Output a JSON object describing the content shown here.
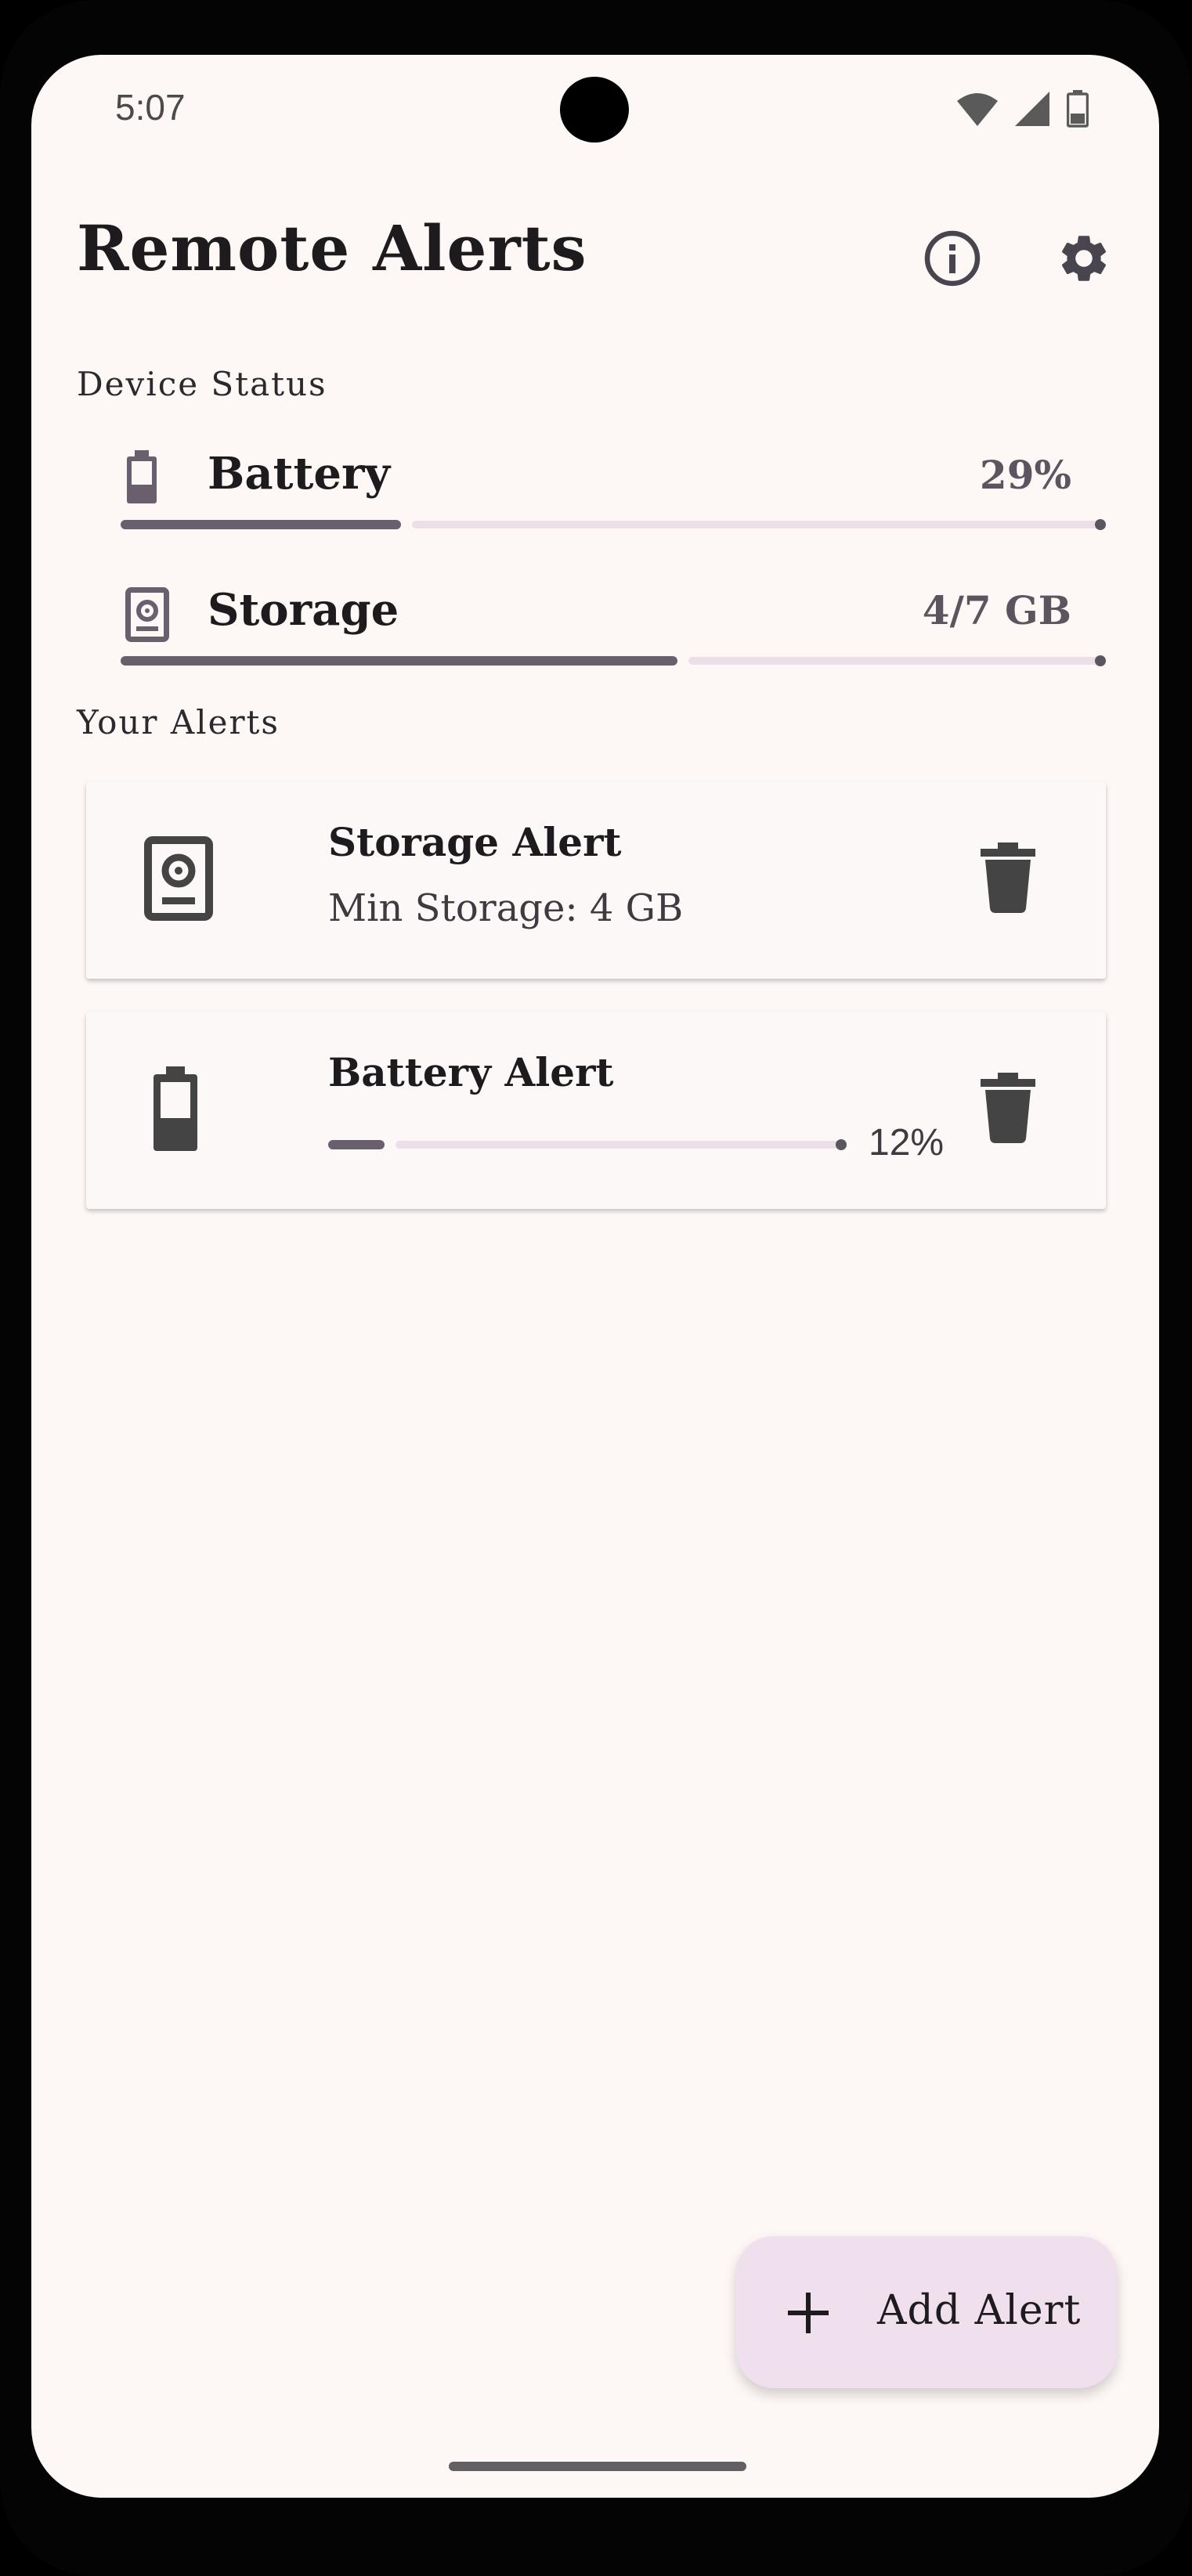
{
  "status_bar": {
    "time": "5:07"
  },
  "app_bar": {
    "title": "Remote Alerts"
  },
  "device_status": {
    "label": "Device Status",
    "battery": {
      "name": "Battery",
      "value": "29%",
      "level": 0.29
    },
    "storage": {
      "name": "Storage",
      "value": "4/7 GB",
      "level": 0.571
    }
  },
  "alerts": {
    "label": "Your Alerts",
    "items": [
      {
        "title": "Storage Alert",
        "detail": "Min Storage: 4 GB"
      },
      {
        "title": "Battery Alert",
        "value": "12%",
        "level": 0.12
      }
    ]
  },
  "fab": {
    "label": "Add Alert"
  },
  "icons": {
    "status": [
      "wifi-icon",
      "signal-icon",
      "battery-status-icon"
    ],
    "app_bar": [
      "info-icon",
      "settings-icon"
    ],
    "cards": [
      "storage-icon",
      "battery-icon",
      "delete-icon"
    ],
    "fab": "add-icon"
  },
  "colors": {
    "background": "#fdf7f6",
    "progress_fill": "#6a5f6d",
    "progress_track": "#ecdfe8",
    "fab_background": "#f0dfec"
  }
}
